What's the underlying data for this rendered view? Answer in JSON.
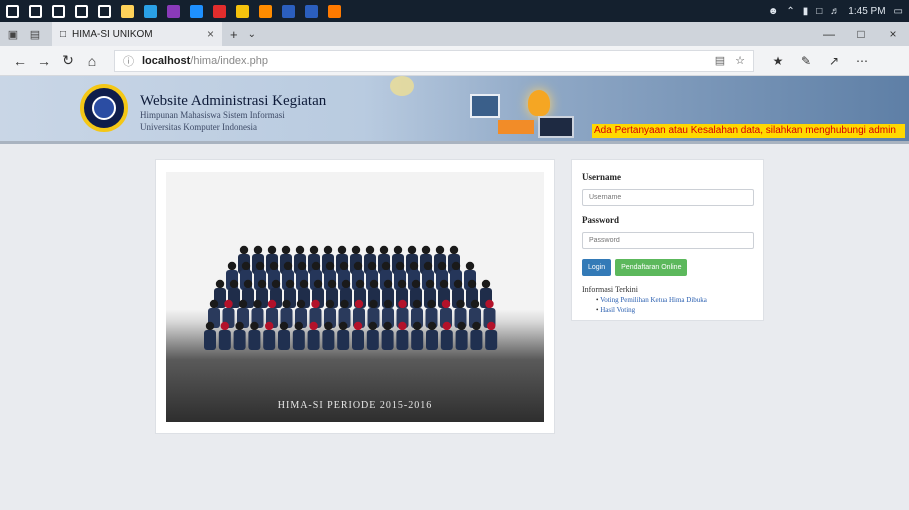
{
  "taskbar": {
    "time": "1:45 PM",
    "icons": [
      "windows-start-icon",
      "search-cortana-icon",
      "task-view-icon",
      "store-icon",
      "mail-icon",
      "explorer-icon",
      "edge-icon",
      "premiere-icon",
      "photoshop-icon",
      "opera-icon",
      "chrome-icon",
      "sublime-icon",
      "word-icon",
      "powerpoint-icon",
      "app-icon"
    ],
    "icon_colors": [
      "#ffffff",
      "#ffffff",
      "#ffffff",
      "#ffffff",
      "#ffffff",
      "#ffd25a",
      "#2aa0e6",
      "#8a3ab9",
      "#1e90ff",
      "#e22d2d",
      "#f4c20d",
      "#ff8c00",
      "#2b5fbf",
      "#2b5fbf",
      "#ff7a00"
    ]
  },
  "browser": {
    "tab_title": "HIMA-SI UNIKOM",
    "url_host": "localhost",
    "url_path": "/hima/index.php"
  },
  "banner": {
    "title": "Website Administrasi Kegiatan",
    "subtitle": "Himpunan Mahasiswa Sistem Informasi",
    "subtitle2": "Universitas Komputer Indonesia",
    "marquee": "Ada Pertanyaan atau Kesalahan data, silahkan menghubungi admin"
  },
  "photo": {
    "caption": "HIMA-SI PERIODE 2015-2016"
  },
  "login": {
    "username_label": "Username",
    "username_placeholder": "Username",
    "password_label": "Password",
    "password_placeholder": "Password",
    "login_button": "Login",
    "register_button": "Pendaftaran Online",
    "info_title": "Informasi Terkini",
    "info_items": [
      "Voting Pemilihan Ketua Hima Dibuka",
      "Hasil Voting"
    ]
  },
  "colors": {
    "accent": "#337ab7",
    "success": "#5cb85c",
    "marquee_bg": "#ffd800",
    "marquee_text": "#d40000"
  }
}
